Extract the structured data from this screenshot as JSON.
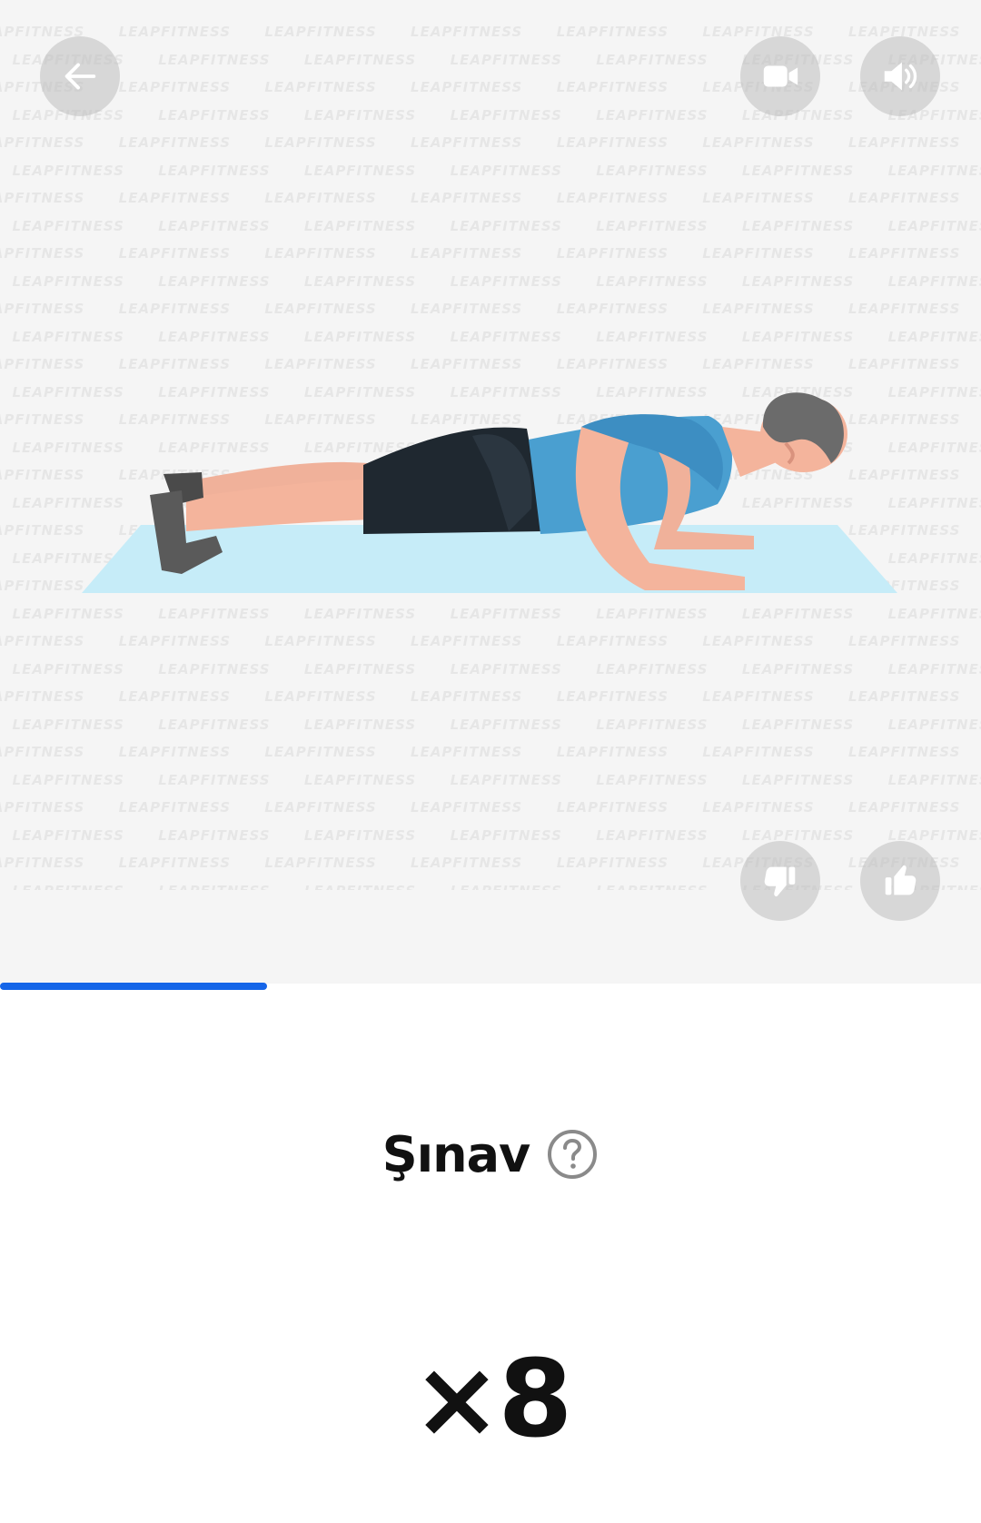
{
  "exercise": {
    "name": "Şınav",
    "reps": "×8"
  },
  "watermark_text": "LEAPFITNESS",
  "progress": {
    "fraction": 0.272
  },
  "icons": {
    "back": "arrow-left-icon",
    "video": "video-camera-icon",
    "sound": "speaker-volume-icon",
    "dislike": "thumbs-down-icon",
    "like": "thumbs-up-icon",
    "help": "question-circle-icon"
  },
  "colors": {
    "accent": "#1565e8",
    "mat": "#c6ecf8",
    "shirt": "#4a9fd0",
    "shorts": "#1f2830",
    "skin": "#f4b49c",
    "hair": "#6b6b6b",
    "shoes": "#555555"
  }
}
